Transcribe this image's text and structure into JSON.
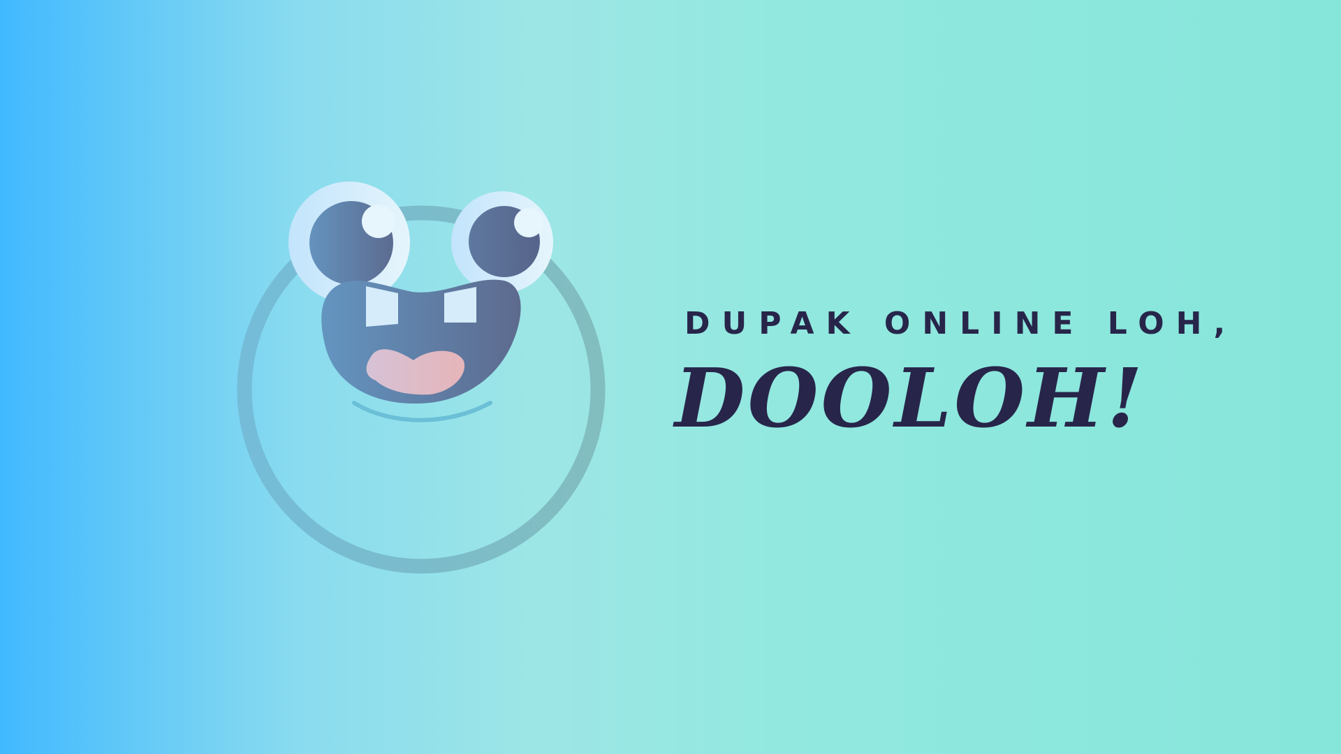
{
  "hero": {
    "tagline": "DUPAK ONLINE LOH,",
    "brand": "DOOLOH!"
  },
  "mascot": {
    "icon": "smiling-frog-mascot-icon"
  },
  "colors": {
    "background_left": "#41b9ff",
    "background_right": "#86e6da",
    "text": "#27254a",
    "eye_white": "#cbe9fb",
    "pupil": "#5c6a8f",
    "mouth": "#5e7797",
    "tongue": "#e0b9c3",
    "outline": "#7bbfd0"
  }
}
